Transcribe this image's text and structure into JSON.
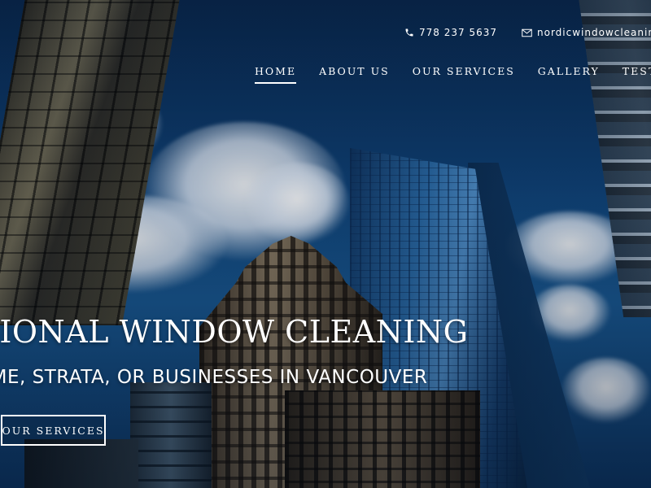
{
  "contact": {
    "phone_icon": "phone-icon",
    "phone": "778 237 5637",
    "email_icon": "envelope-icon",
    "email": "nordicwindowcleaning@"
  },
  "nav": {
    "items": [
      {
        "label": "HOME",
        "active": true
      },
      {
        "label": "ABOUT US",
        "active": false
      },
      {
        "label": "OUR SERVICES",
        "active": false
      },
      {
        "label": "GALLERY",
        "active": false
      },
      {
        "label": "TESTIMONI",
        "active": false
      }
    ]
  },
  "hero": {
    "headline": "SSIONAL WINDOW CLEANING",
    "subline": "OME, STRATA, OR BUSINESSES IN VANCOUVER",
    "cta_label": "OUR SERVICES"
  },
  "colors": {
    "text": "#ffffff",
    "sky": "#0f4277"
  }
}
